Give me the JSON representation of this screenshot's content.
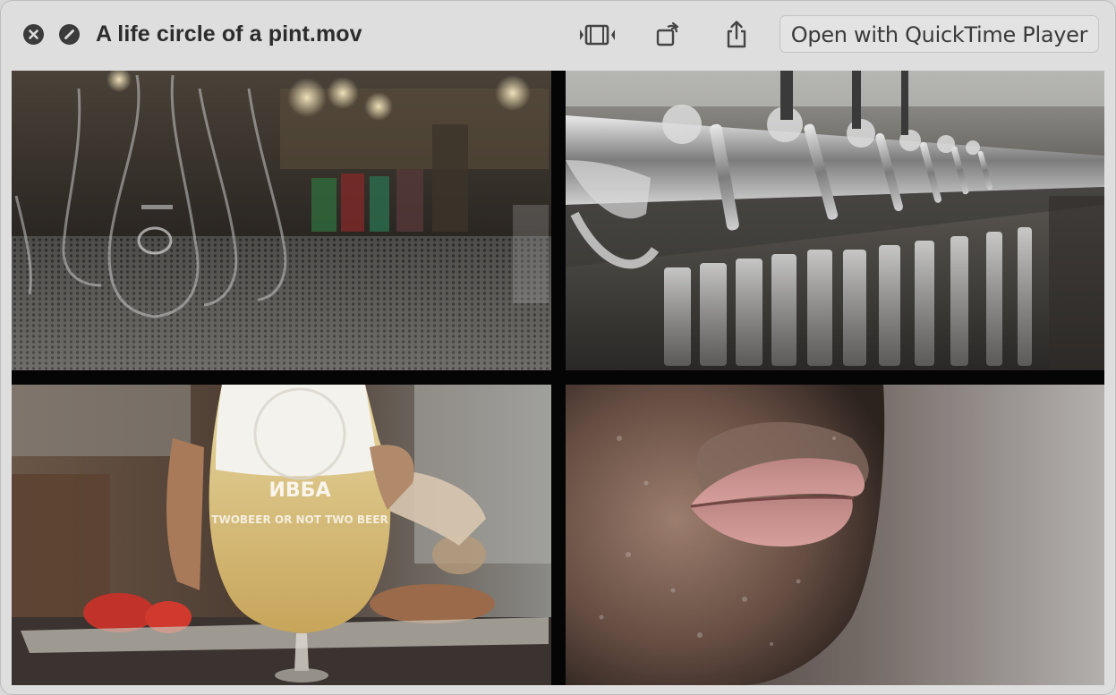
{
  "window": {
    "title": "A life circle of a pint.mov"
  },
  "titlebar": {
    "close_icon": "close-icon",
    "stop_icon": "no-entry-icon",
    "trim_icon": "trim-film-icon",
    "rotate_icon": "rotate-icon",
    "share_icon": "share-icon",
    "open_button_label": "Open with QuickTime Player"
  },
  "video": {
    "glass_text_1": "ИВБА",
    "glass_text_2": "TWOBEER OR NOT TWO BEER"
  },
  "colors": {
    "window_bg": "#dedede",
    "titlebar_text": "#2c2c2c",
    "video_bg": "#050505"
  }
}
